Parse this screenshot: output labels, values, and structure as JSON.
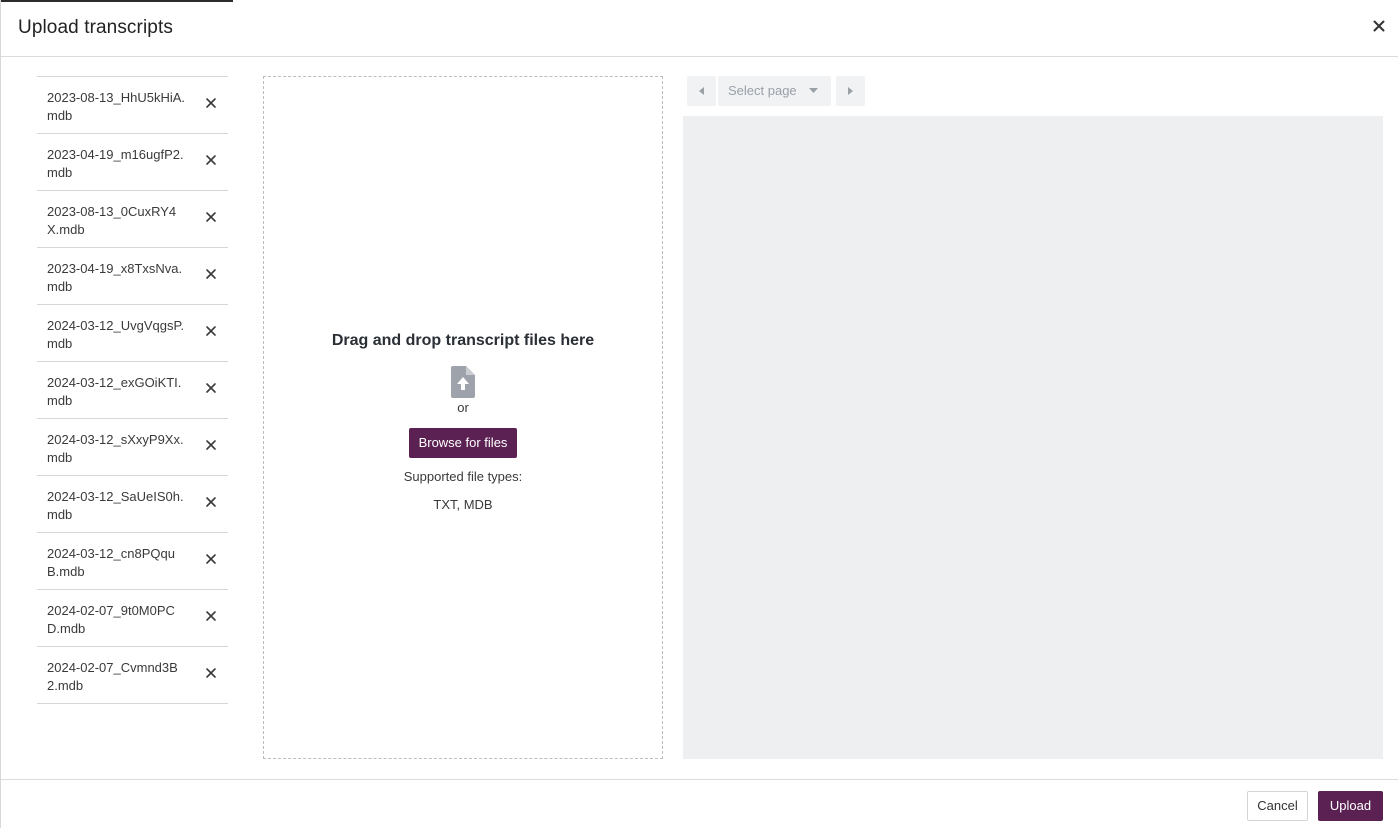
{
  "dialog": {
    "title": "Upload transcripts",
    "close_icon": "close-icon"
  },
  "files": [
    {
      "name": "2023-08-13_HhU5kHiA.mdb"
    },
    {
      "name": "2023-04-19_m16ugfP2.mdb"
    },
    {
      "name": "2023-08-13_0CuxRY4X.mdb"
    },
    {
      "name": "2023-04-19_x8TxsNva.mdb"
    },
    {
      "name": "2024-03-12_UvgVqgsP.mdb"
    },
    {
      "name": "2024-03-12_exGOiKTI.mdb"
    },
    {
      "name": "2024-03-12_sXxyP9Xx.mdb"
    },
    {
      "name": "2024-03-12_SaUeIS0h.mdb"
    },
    {
      "name": "2024-03-12_cn8PQquB.mdb"
    },
    {
      "name": "2024-02-07_9t0M0PCD.mdb"
    },
    {
      "name": "2024-02-07_Cvmnd3B2.mdb"
    }
  ],
  "dropzone": {
    "title": "Drag and drop transcript files here",
    "icon": "file-upload-icon",
    "or": "or",
    "browse_label": "Browse for files",
    "supported_label": "Supported file types:",
    "types": "TXT, MDB"
  },
  "pager": {
    "select_placeholder": "Select page"
  },
  "footer": {
    "cancel_label": "Cancel",
    "upload_label": "Upload"
  },
  "colors": {
    "primary": "#5b2153",
    "preview_bg": "#eeeff1"
  }
}
